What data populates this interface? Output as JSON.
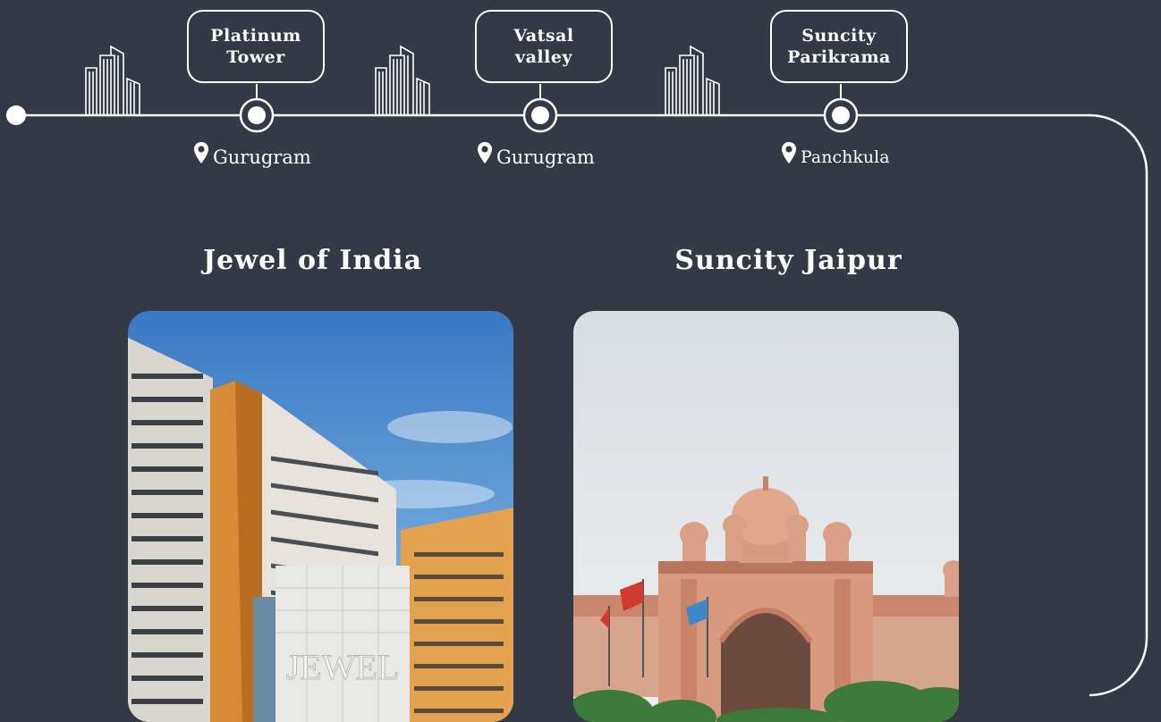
{
  "timeline": {
    "projects": [
      {
        "name": "Platinum\nTower",
        "location": "Gurugram"
      },
      {
        "name": "Vatsal\nvalley",
        "location": "Gurugram"
      },
      {
        "name": "Suncity\nParikrama",
        "location": "Panchkula"
      }
    ]
  },
  "cards": [
    {
      "title": "Jewel of India",
      "image_label": "JEWEL"
    },
    {
      "title": "Suncity Jaipur"
    }
  ],
  "colors": {
    "background": "#343a45",
    "line": "#ffffff"
  },
  "icons": {
    "building": "buildings-icon",
    "marker": "timeline-marker-icon",
    "location": "location-pin-icon"
  }
}
